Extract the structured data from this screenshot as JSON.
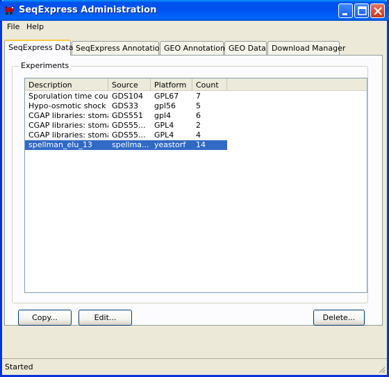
{
  "window": {
    "title": "SeqExpress Administration"
  },
  "menu": {
    "items": [
      "File",
      "Help"
    ]
  },
  "tabs": [
    "SeqExpress Data",
    "SeqExpress Annotations",
    "GEO Annotations",
    "GEO Data",
    "Download Manager"
  ],
  "group": {
    "label": "Experiments"
  },
  "table": {
    "columns": [
      "Description",
      "Source",
      "Platform",
      "Count"
    ],
    "rows": [
      [
        "Sporulation time course",
        "GDS104",
        "GPL67",
        "7"
      ],
      [
        "Hypo-osmotic shock ti...",
        "GDS33",
        "gpl56",
        "5"
      ],
      [
        "CGAP libraries: stomach",
        "GDS551",
        "gpl4",
        "6"
      ],
      [
        "CGAP libraries: stoma...",
        "GDS55...",
        "GPL4",
        "2"
      ],
      [
        "CGAP libraries: stoma...",
        "GDS55...",
        "GPL4",
        "4"
      ],
      [
        "spellman_elu_13",
        "spellma...",
        "yeastorf",
        "14"
      ]
    ],
    "selected_row": 5
  },
  "buttons": {
    "copy": "Copy...",
    "edit": "Edit...",
    "delete": "Delete..."
  },
  "status": {
    "text": "Started"
  },
  "colors": {
    "titlebar": "#0054e3",
    "selection": "#316ac5",
    "active_tab_accent": "#ffc83c"
  }
}
